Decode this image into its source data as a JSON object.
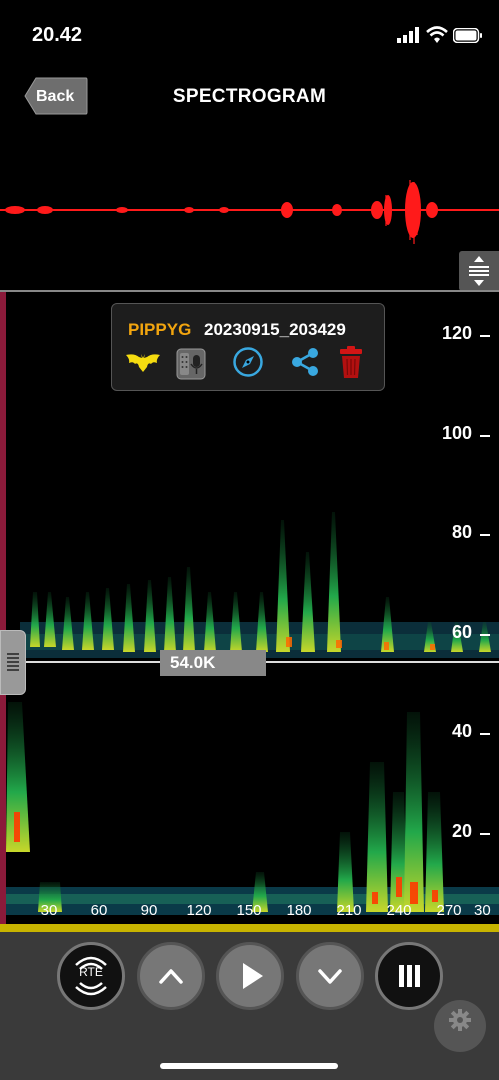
{
  "status_bar": {
    "time": "20.42",
    "signal_icon": "signal-bars-icon",
    "wifi_icon": "wifi-icon",
    "battery_icon": "battery-icon"
  },
  "header": {
    "back_label": "Back",
    "title": "SPECTROGRAM"
  },
  "recording": {
    "species": "PIPPYG",
    "filename": "20230915_203429"
  },
  "card_actions": [
    "bat-icon",
    "recorder-icon",
    "compass-icon",
    "share-icon",
    "trash-icon"
  ],
  "spectrogram": {
    "y_labels": [
      "120",
      "100",
      "80",
      "60",
      "40",
      "20"
    ],
    "x_labels": [
      "30",
      "60",
      "90",
      "120",
      "150",
      "180",
      "210",
      "240",
      "270",
      "30"
    ],
    "threshold_label": "54.0K"
  },
  "toolbar": {
    "rte_label": "RTE",
    "buttons": [
      "rte-button",
      "scroll-up-button",
      "play-button",
      "scroll-down-button",
      "pause-button"
    ]
  },
  "colors": {
    "accent": "#f2a50f",
    "waveform": "#ff1a1a",
    "progress": "#c8b400",
    "share": "#39a8e0",
    "trash": "#d21515"
  }
}
